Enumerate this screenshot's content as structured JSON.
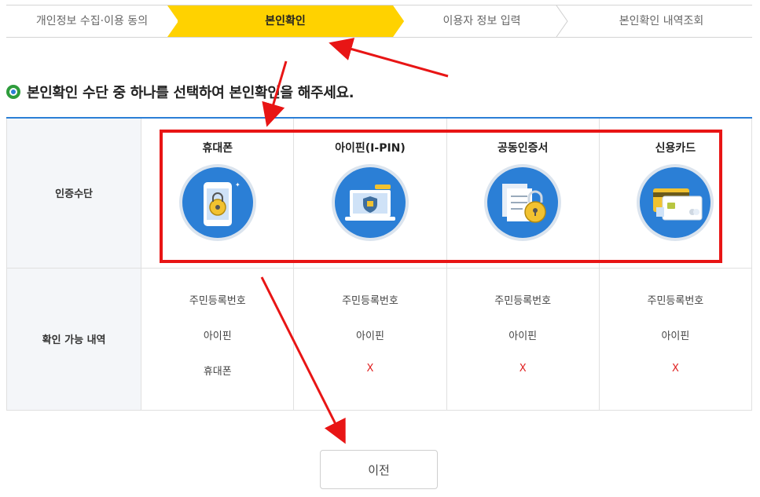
{
  "steps": [
    {
      "label": "개인정보 수집·이용 동의",
      "active": false
    },
    {
      "label": "본인확인",
      "active": true
    },
    {
      "label": "이용자 정보 입력",
      "active": false
    },
    {
      "label": "본인확인 내역조회",
      "active": false
    }
  ],
  "heading": "본인확인 수단 중 하나를 선택하여 본인확인을 해주세요.",
  "table": {
    "row1_header": "인증수단",
    "row2_header": "확인 가능 내역",
    "methods": [
      {
        "name": "휴대폰",
        "icon": "phone-lock-icon",
        "checks": [
          "주민등록번호",
          "아이핀",
          "휴대폰"
        ]
      },
      {
        "name": "아이핀(I-PIN)",
        "icon": "laptop-shield-icon",
        "checks": [
          "주민등록번호",
          "아이핀",
          "X"
        ]
      },
      {
        "name": "공동인증서",
        "icon": "certificate-lock-icon",
        "checks": [
          "주민등록번호",
          "아이핀",
          "X"
        ]
      },
      {
        "name": "신용카드",
        "icon": "credit-card-icon",
        "checks": [
          "주민등록번호",
          "아이핀",
          "X"
        ]
      }
    ]
  },
  "prev_button": "이전",
  "colors": {
    "accent": "#ffd200",
    "brand_blue": "#2b7fd6",
    "annotation_red": "#e81515"
  }
}
